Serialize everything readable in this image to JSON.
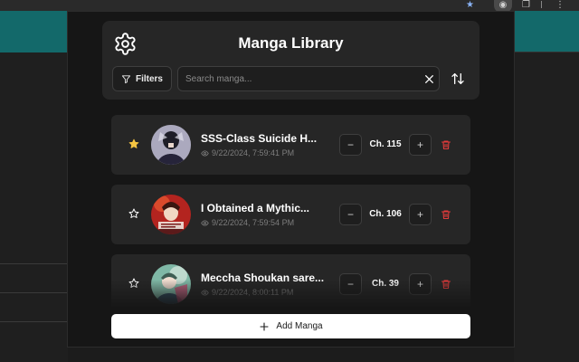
{
  "browser": {
    "icons": [
      "bookmark-star-icon",
      "extension-icon",
      "copy-icon",
      "more-icon"
    ]
  },
  "popup": {
    "title": "Manga Library",
    "settings_icon": "gear-icon",
    "filters_label": "Filters",
    "search": {
      "placeholder": "Search manga...",
      "value": ""
    },
    "clear_icon": "close-icon",
    "sort_icon": "sort-arrows-icon",
    "add_label": "Add Manga"
  },
  "manga": [
    {
      "title": "SSS-Class Suicide H...",
      "date": "9/22/2024, 7:59:41 PM",
      "chapter": "Ch. 115",
      "favorite": true
    },
    {
      "title": "I Obtained a Mythic...",
      "date": "9/22/2024, 7:59:54 PM",
      "chapter": "Ch. 106",
      "favorite": false
    },
    {
      "title": "Meccha Shoukan sare...",
      "date": "9/22/2024, 8:00:11 PM",
      "chapter": "Ch. 39",
      "favorite": false
    }
  ],
  "colors": {
    "accent_star": "#f5c542",
    "delete": "#e23b3b",
    "panel": "#262626",
    "background": "#161616",
    "teal": "#13696a"
  }
}
